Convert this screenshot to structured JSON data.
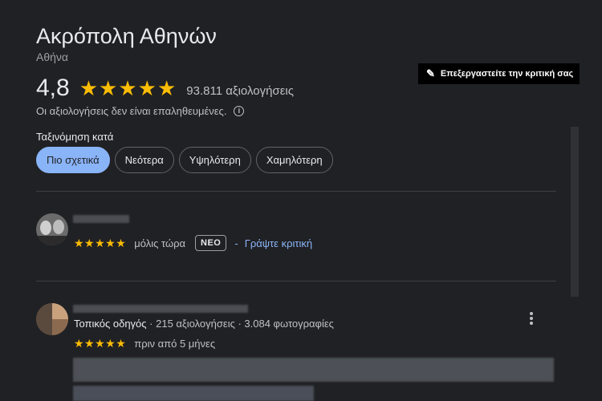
{
  "place": {
    "title": "Ακρόπολη Αθηνών",
    "location": "Αθήνα",
    "rating": "4,8",
    "stars": "★★★★★",
    "review_count": "93.811 αξιολογήσεις",
    "verification_note": "Οι αξιολογήσεις δεν είναι επαληθευμένες.",
    "info_icon": "i"
  },
  "edit_review": {
    "label": "Επεξεργαστείτε την κριτική σας",
    "icon": "pencil-icon"
  },
  "sort": {
    "label": "Ταξινόμηση κατά",
    "options": [
      "Πιο σχετικά",
      "Νεότερα",
      "Υψηλότερη",
      "Χαμηλότερη"
    ],
    "selected": "Πιο σχετικά"
  },
  "reviews": [
    {
      "stars": "★★★★★",
      "time": "μόλις τώρα",
      "badge": "ΝΕΟ",
      "separator": "-",
      "action": "Γράψτε κριτική"
    },
    {
      "role": "Τοπικός οδηγός",
      "stats": " · 215 αξιολογήσεις · 3.084 φωτογραφίες",
      "stars": "★★★★★",
      "time": "πριν από 5 μήνες"
    }
  ],
  "colors": {
    "accent": "#8ab4f8",
    "star": "#fbbc04",
    "background": "#202124"
  }
}
